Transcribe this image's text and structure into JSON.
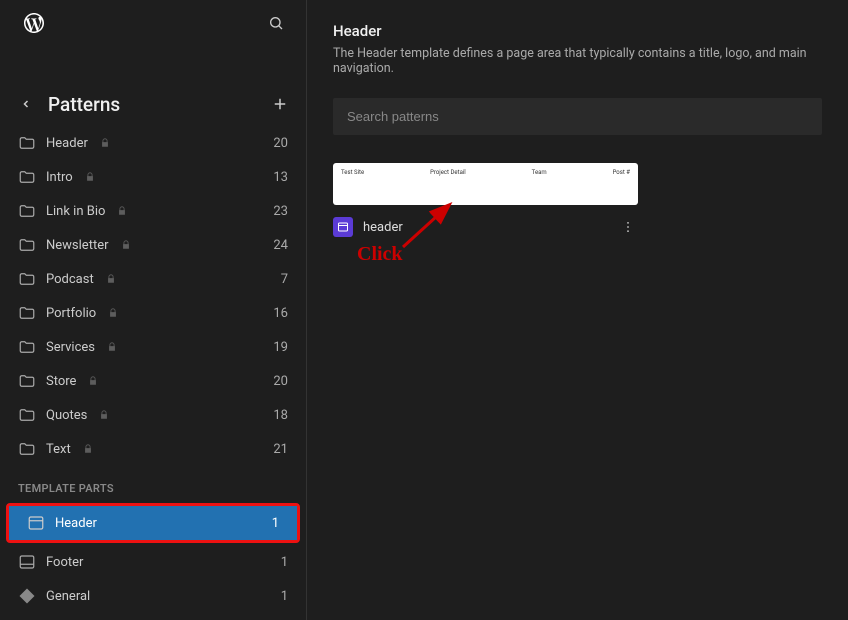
{
  "sidebar": {
    "title": "Patterns",
    "pattern_items": [
      {
        "label": "Header",
        "count": "20",
        "locked": true
      },
      {
        "label": "Intro",
        "count": "13",
        "locked": true
      },
      {
        "label": "Link in Bio",
        "count": "23",
        "locked": true
      },
      {
        "label": "Newsletter",
        "count": "24",
        "locked": true
      },
      {
        "label": "Podcast",
        "count": "7",
        "locked": true
      },
      {
        "label": "Portfolio",
        "count": "16",
        "locked": true
      },
      {
        "label": "Services",
        "count": "19",
        "locked": true
      },
      {
        "label": "Store",
        "count": "20",
        "locked": true
      },
      {
        "label": "Quotes",
        "count": "18",
        "locked": true
      },
      {
        "label": "Text",
        "count": "21",
        "locked": true
      }
    ],
    "template_parts_heading": "TEMPLATE PARTS",
    "template_parts": [
      {
        "label": "Header",
        "count": "1",
        "selected": true,
        "icon": "header"
      },
      {
        "label": "Footer",
        "count": "1",
        "selected": false,
        "icon": "footer"
      },
      {
        "label": "General",
        "count": "1",
        "selected": false,
        "icon": "general"
      }
    ]
  },
  "main": {
    "title": "Header",
    "description": "The Header template defines a page area that typically contains a title, logo, and main navigation.",
    "search_placeholder": "Search patterns",
    "card": {
      "label": "header",
      "items": [
        "Test Site",
        "Project Detail",
        "Team",
        "Post #"
      ]
    }
  },
  "annotation": {
    "text": "Click"
  }
}
